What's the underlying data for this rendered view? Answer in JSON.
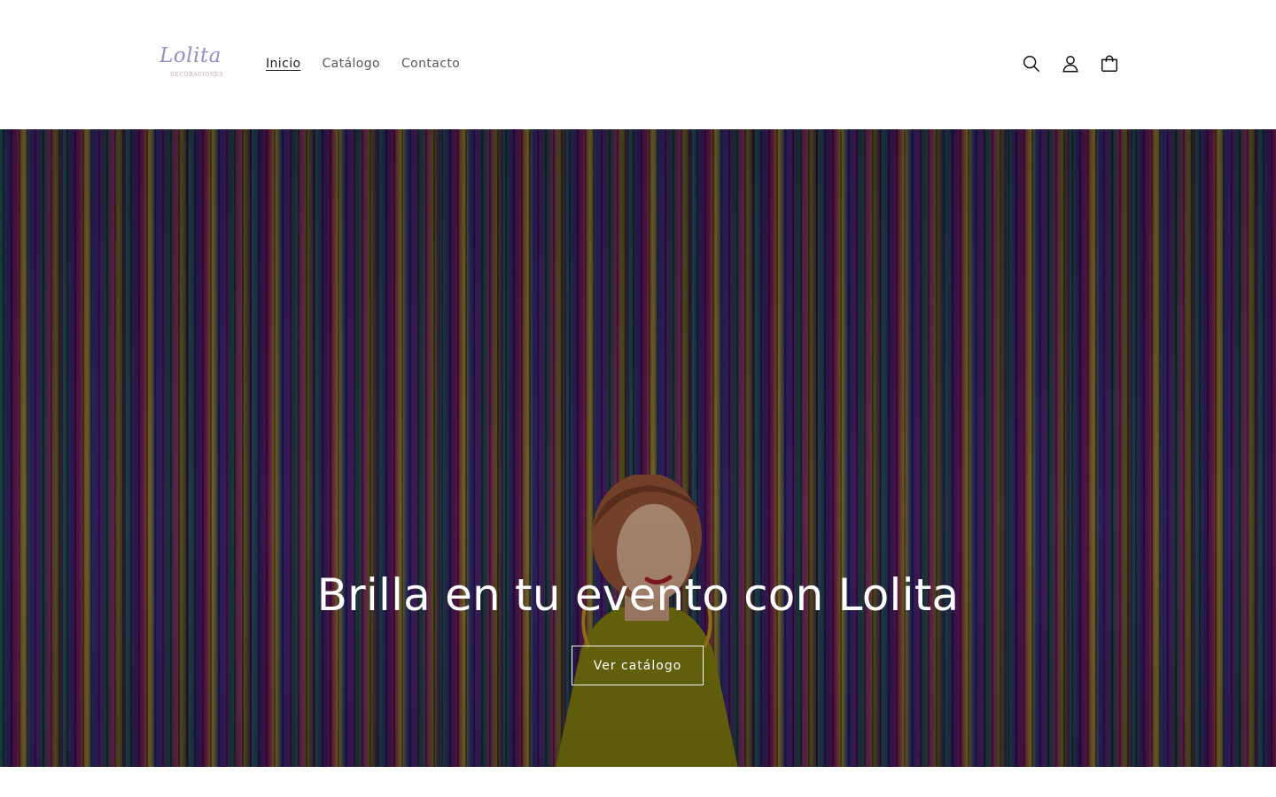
{
  "logo": {
    "name": "Lolita",
    "tagline": "DECORACIONES"
  },
  "nav": {
    "items": [
      {
        "label": "Inicio",
        "active": true
      },
      {
        "label": "Catálogo",
        "active": false
      },
      {
        "label": "Contacto",
        "active": false
      }
    ]
  },
  "header_icons": [
    "search-icon",
    "account-icon",
    "cart-icon"
  ],
  "hero": {
    "title": "Brilla en tu evento con Lolita",
    "button_label": "Ver catálogo"
  },
  "colors": {
    "text": "#121212",
    "logo_purple": "#9b8cc4",
    "logo_pink": "#c9a3b8",
    "hero_text": "#ffffff"
  }
}
